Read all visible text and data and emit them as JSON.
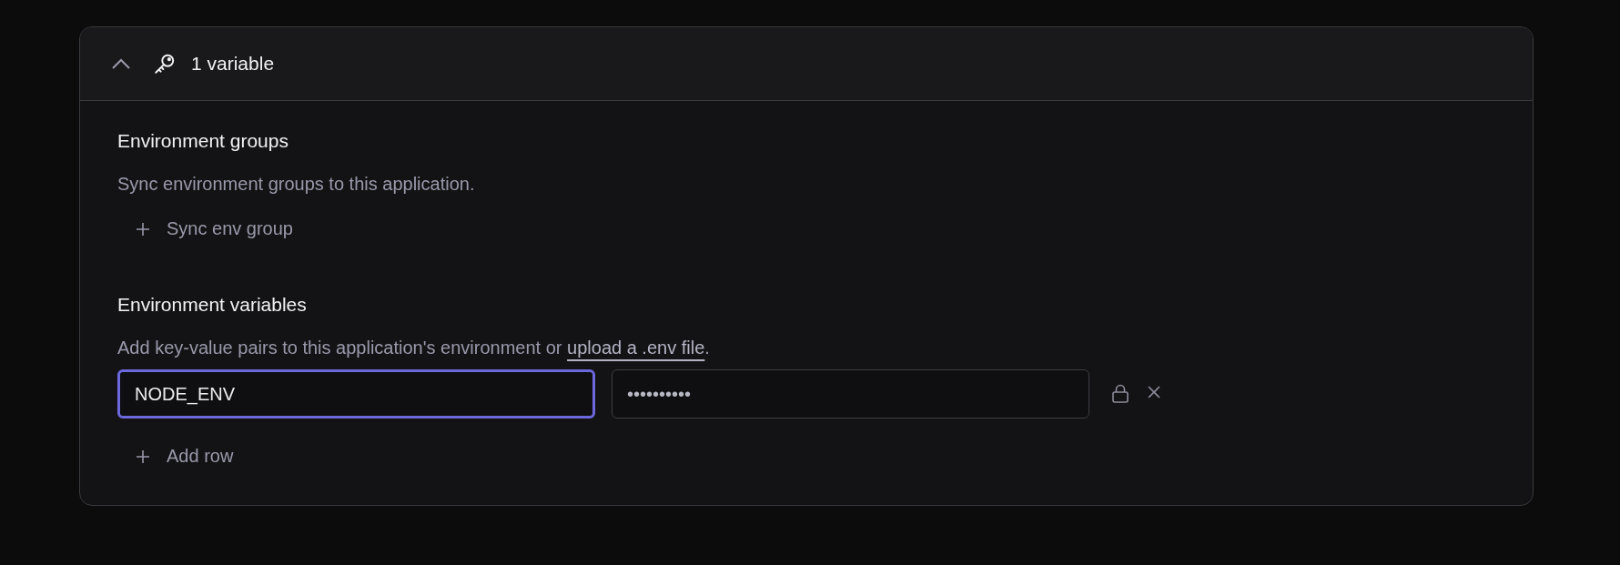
{
  "panel": {
    "title": "1 variable",
    "expanded": true
  },
  "groups_section": {
    "heading": "Environment groups",
    "description": "Sync environment groups to this application.",
    "action": "Sync env group"
  },
  "variables_section": {
    "heading": "Environment variables",
    "description": "Add key-value pairs to this application's environment or ",
    "link": "upload a .env file",
    "description_end": ".",
    "rows": [
      {
        "key": "NODE_ENV",
        "value": "••••••••••",
        "key_focused": true,
        "locked": true
      }
    ],
    "action": "Add row"
  }
}
